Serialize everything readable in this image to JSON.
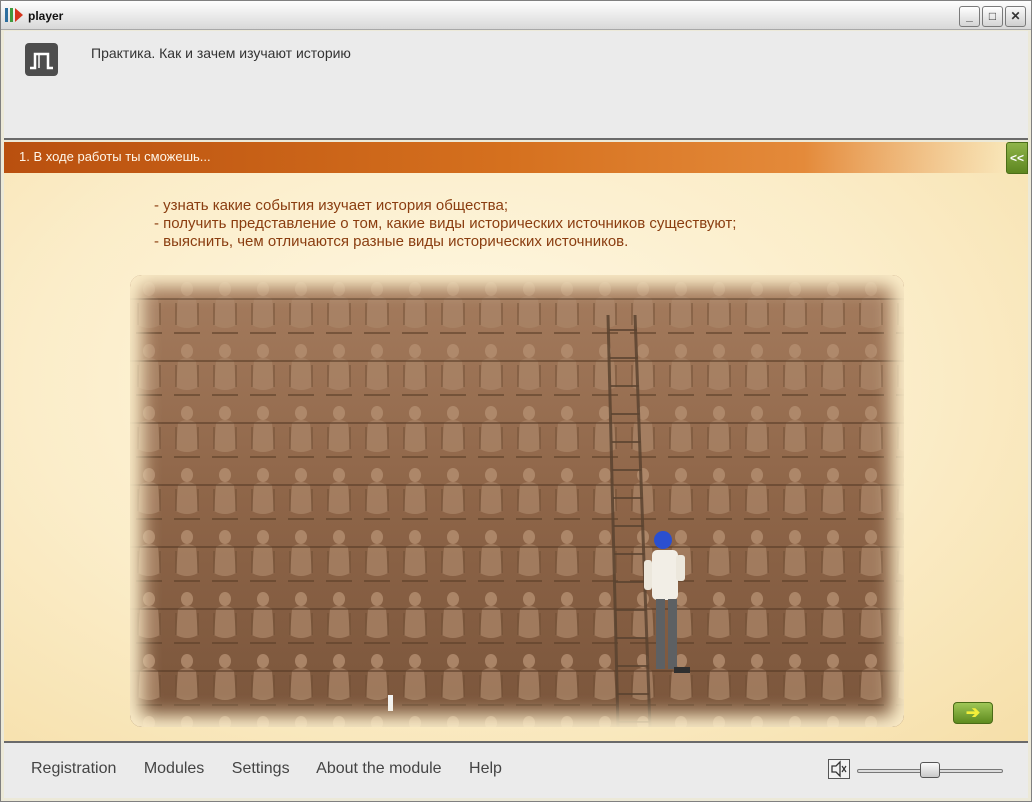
{
  "window": {
    "title": "player",
    "minimize": "_",
    "maximize": "□",
    "close": "✕"
  },
  "header": {
    "logo_icon": "book-logo-icon",
    "title": "Практика. Как и зачем изучают историю"
  },
  "content": {
    "section_title": "1. В ходе работы ты сможешь...",
    "collapse_label": "<<",
    "bullets": [
      "- узнать какие события изучает история общества;",
      "- получить представление о том, какие виды исторических источников существуют;",
      "- выяснить, чем отличаются разные виды исторических источников."
    ],
    "image_icon": "temple-bas-relief-photo",
    "next_label": "➔"
  },
  "footer": {
    "nav": [
      "Registration",
      "Modules",
      "Settings",
      "About the module",
      "Help"
    ],
    "volume_icon": "speaker-icon",
    "volume_level": 0.5
  },
  "colors": {
    "accent_orange": "#d5701e",
    "bullet_text": "#8a3d10",
    "button_green": "#5e8a1e"
  }
}
